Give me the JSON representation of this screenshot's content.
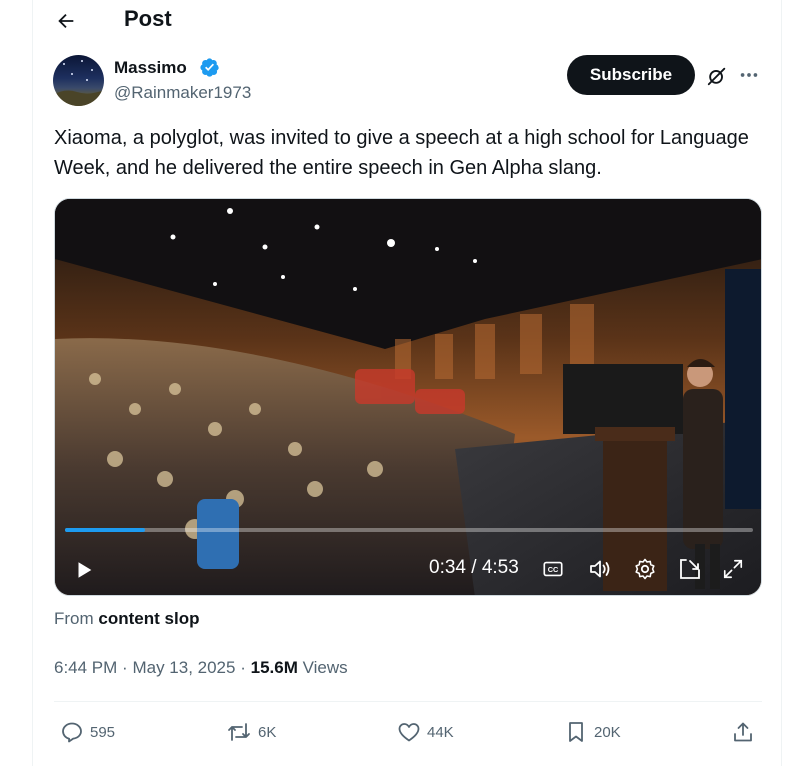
{
  "header": {
    "title": "Post"
  },
  "author": {
    "name": "Massimo",
    "handle": "@Rainmaker1973",
    "subscribe_label": "Subscribe"
  },
  "tweet": {
    "text": "Xiaoma, a polyglot, was invited to give a speech at a high school for Language Week, and he delivered the entire speech in Gen Alpha slang."
  },
  "video": {
    "timecode": "0:34 / 4:53",
    "progress": 0.116
  },
  "source": {
    "prefix": "From",
    "name": "content slop"
  },
  "meta": {
    "time": "6:44 PM",
    "date": "May 13, 2025",
    "sep": "·",
    "views_count": "15.6M",
    "views_label": "Views"
  },
  "actions": {
    "replies": "595",
    "reposts": "6K",
    "likes": "44K",
    "bookmarks": "20K"
  },
  "colors": {
    "accent": "#1d9bf0",
    "text": "#0f1419",
    "secondary": "#536471"
  }
}
